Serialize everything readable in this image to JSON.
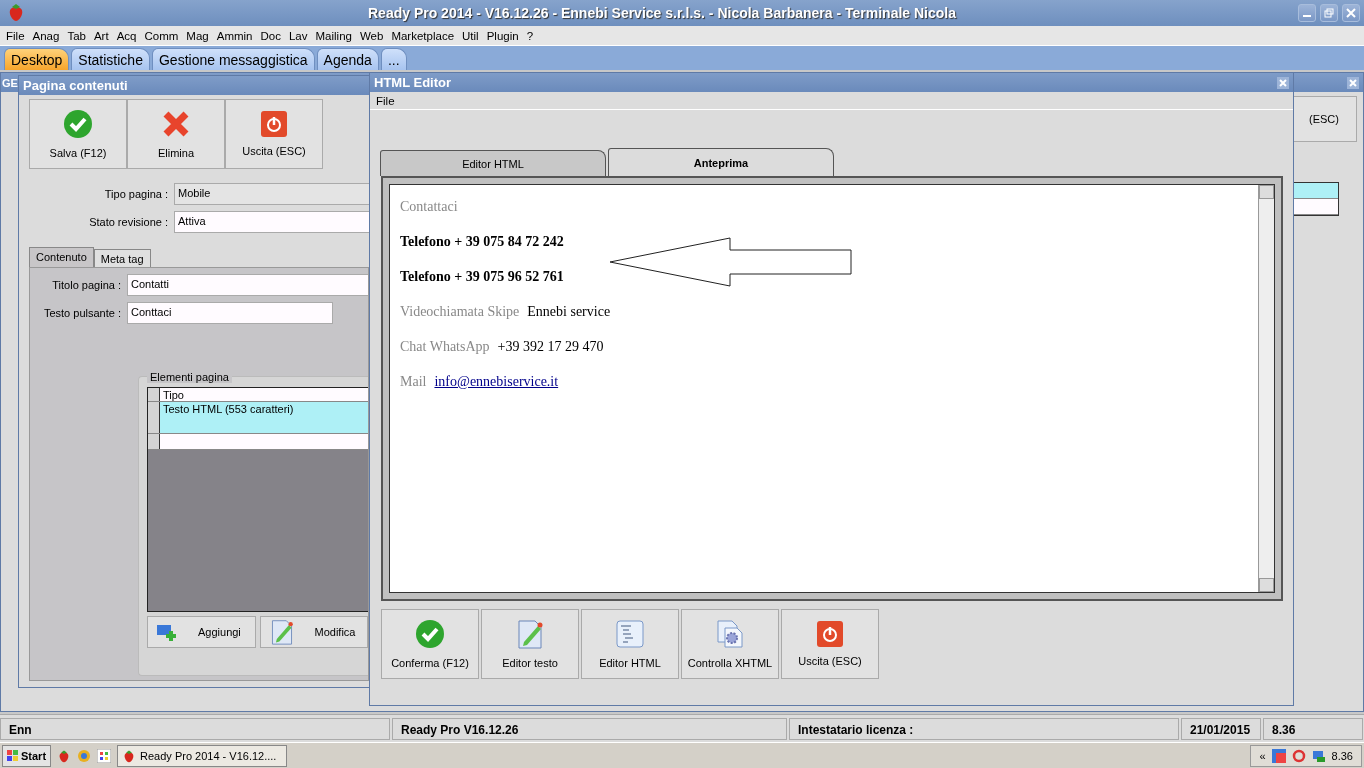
{
  "window": {
    "title": "Ready Pro 2014 - V16.12.26 - Ennebi Service s.r.l.s. - Nicola Barbanera - Terminale Nicola"
  },
  "menu": [
    "File",
    "Anag",
    "Tab",
    "Art",
    "Acq",
    "Comm",
    "Mag",
    "Ammin",
    "Doc",
    "Lav",
    "Mailing",
    "Web",
    "Marketplace",
    "Util",
    "Plugin",
    "?"
  ],
  "tabs": [
    {
      "label": "Desktop",
      "selected": true
    },
    {
      "label": "Statistiche",
      "selected": false
    },
    {
      "label": "Gestione messaggistica",
      "selected": false
    },
    {
      "label": "Agenda",
      "selected": false
    },
    {
      "label": "...",
      "selected": false
    }
  ],
  "background_window": {
    "title": "GE",
    "button": "(ESC)",
    "grid_rows": [
      {
        "selected": true
      },
      {
        "selected": false
      }
    ]
  },
  "content_window": {
    "title": "Pagina contenuti",
    "toolbar": [
      {
        "label": "Salva (F12)",
        "kind": "check"
      },
      {
        "label": "Elimina",
        "kind": "cross"
      },
      {
        "label": "Uscita (ESC)",
        "kind": "power"
      }
    ],
    "fields": [
      {
        "label": "Tipo pagina :",
        "value": "Mobile",
        "disabled": true
      },
      {
        "label": "Stato revisione :",
        "value": "Attiva",
        "disabled": false
      }
    ],
    "tabs": [
      {
        "label": "Contenuto",
        "selected": true
      },
      {
        "label": "Meta tag",
        "selected": false
      }
    ],
    "tab_fields": [
      {
        "label": "Titolo pagina :",
        "value": "Contatti",
        "wide": true
      },
      {
        "label": "Testo pulsante :",
        "value": "Conttaci",
        "wide": false
      }
    ],
    "elements": {
      "title": "Elementi pagina",
      "columns": [
        "Tipo"
      ],
      "rows": [
        {
          "cells": [
            "Testo HTML (553 caratteri)"
          ],
          "selected": true
        }
      ]
    },
    "buttons": [
      {
        "label": "Aggiungi",
        "kind": "add"
      },
      {
        "label": "Modifica",
        "kind": "edit"
      }
    ]
  },
  "editor": {
    "title": "HTML Editor",
    "menu": [
      "File"
    ],
    "tabs": [
      {
        "label": "Editor HTML",
        "selected": false
      },
      {
        "label": "Anteprima",
        "selected": true
      }
    ],
    "preview": [
      {
        "kind": "muted",
        "text": "Contattaci"
      },
      {
        "kind": "bold",
        "text": "Telefono + 39 075 84 72 242"
      },
      {
        "kind": "bold",
        "text": "Telefono + 39 075 96 52 761"
      },
      {
        "kind": "pair",
        "label": "Videochiamata Skipe",
        "value": "Ennebi service"
      },
      {
        "kind": "pair",
        "label": "Chat WhatsApp",
        "value": "+39 392 17 29 470"
      },
      {
        "kind": "link",
        "label": "Mail",
        "value": "info@ennebiservice.it"
      }
    ],
    "buttons": [
      {
        "label": "Conferma (F12)",
        "kind": "check"
      },
      {
        "label": "Editor testo",
        "kind": "edit"
      },
      {
        "label": "Editor HTML",
        "kind": "html"
      },
      {
        "label": "Controlla XHTML",
        "kind": "gear"
      },
      {
        "label": "Uscita (ESC)",
        "kind": "power"
      }
    ]
  },
  "status_bar": [
    "Enn",
    "Ready Pro V16.12.26",
    "Intestatario licenza :",
    "21/01/2015",
    "8.36"
  ],
  "taskbar": {
    "start": "Start",
    "apps": [
      {
        "label": "Ready Pro 2014 - V16.12....",
        "selected": false
      }
    ],
    "tray_toggle": "«",
    "clock": "8.36"
  }
}
